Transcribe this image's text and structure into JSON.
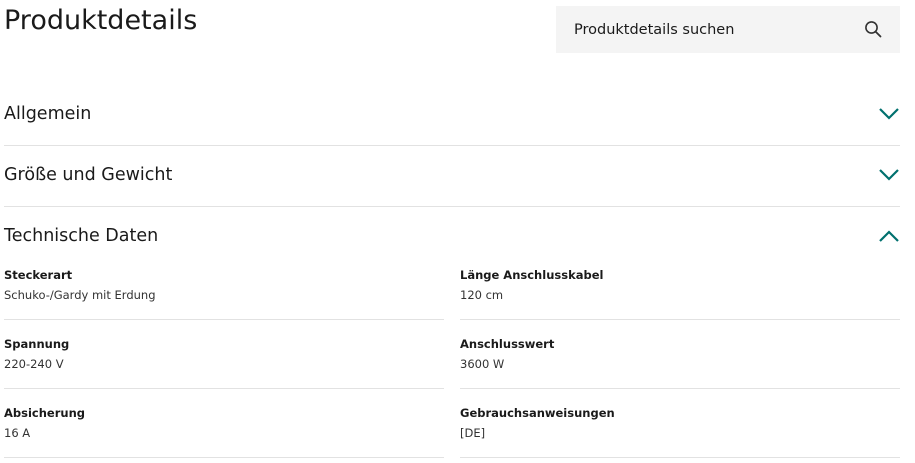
{
  "page": {
    "title": "Produktdetails"
  },
  "search": {
    "placeholder": "Produktdetails suchen",
    "icon": "search-icon"
  },
  "colors": {
    "accent": "#00706e",
    "divider": "#e2e2e2",
    "search_bg": "#f4f4f4"
  },
  "sections": [
    {
      "title": "Allgemein",
      "expanded": false,
      "icon": "chevron-down-icon"
    },
    {
      "title": "Größe und Gewicht",
      "expanded": false,
      "icon": "chevron-down-icon"
    },
    {
      "title": "Technische Daten",
      "expanded": true,
      "icon": "chevron-up-icon"
    }
  ],
  "specs": [
    {
      "label": "Steckerart",
      "value": "Schuko-/Gardy mit Erdung"
    },
    {
      "label": "Länge Anschlusskabel",
      "value": "120 cm"
    },
    {
      "label": "Spannung",
      "value": "220-240 V"
    },
    {
      "label": "Anschlusswert",
      "value": "3600 W"
    },
    {
      "label": "Absicherung",
      "value": "16 A"
    },
    {
      "label": "Gebrauchsanweisungen",
      "value": "[DE]"
    }
  ]
}
